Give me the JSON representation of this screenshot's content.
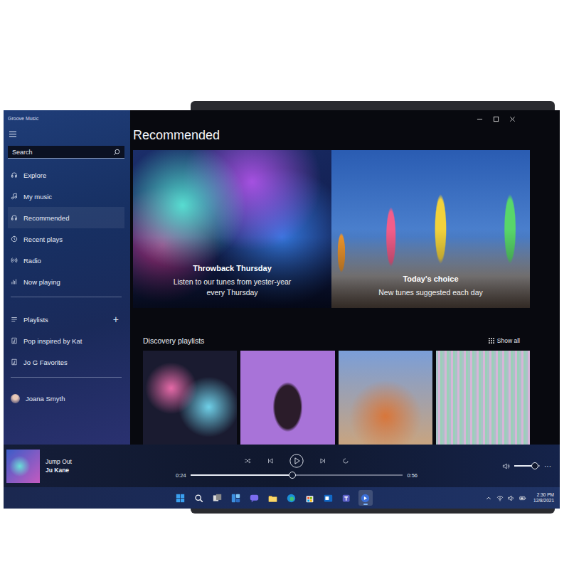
{
  "window": {
    "title": "Groove Music"
  },
  "sidebar": {
    "search": {
      "placeholder": "Search"
    },
    "items": [
      {
        "label": "Explore",
        "selected": false
      },
      {
        "label": "My music",
        "selected": false
      },
      {
        "label": "Recommended",
        "selected": true
      },
      {
        "label": "Recent plays",
        "selected": false
      },
      {
        "label": "Radio",
        "selected": false
      },
      {
        "label": "Now playing",
        "selected": false
      }
    ],
    "playlists_header": {
      "label": "Playlists",
      "add": "+"
    },
    "playlists": [
      {
        "label": "Pop inspired by Kat"
      },
      {
        "label": "Jo G Favorites"
      }
    ],
    "user": {
      "name": "Joana Smyth"
    }
  },
  "main": {
    "title": "Recommended",
    "hero": [
      {
        "title": "Throwback Thursday",
        "subtitle": "Listen to our tunes from yester-year every Thursday"
      },
      {
        "title": "Today's choice",
        "subtitle": "New tunes suggested each day"
      }
    ],
    "discovery": {
      "title": "Discovery playlists",
      "show_all": "Show all"
    }
  },
  "player": {
    "track": "Jump Out",
    "artist": "Ju Kane",
    "elapsed": "0:24",
    "duration": "0:56",
    "level": 0.48,
    "playing": false,
    "volume": {
      "level": 0.8
    },
    "more": "···"
  },
  "taskbar": {
    "apps": [
      {
        "kind": "start",
        "active": false
      },
      {
        "kind": "search",
        "active": false
      },
      {
        "kind": "taskview",
        "active": false
      },
      {
        "kind": "widgets",
        "active": false
      },
      {
        "kind": "chat",
        "active": false
      },
      {
        "kind": "explorer",
        "active": false
      },
      {
        "kind": "edge",
        "active": false
      },
      {
        "kind": "store",
        "active": false
      },
      {
        "kind": "mail",
        "active": false
      },
      {
        "kind": "teams",
        "active": false
      },
      {
        "kind": "groove",
        "active": true
      }
    ],
    "clock": {
      "time": "2:30 PM",
      "date": "12/8/2021"
    }
  }
}
